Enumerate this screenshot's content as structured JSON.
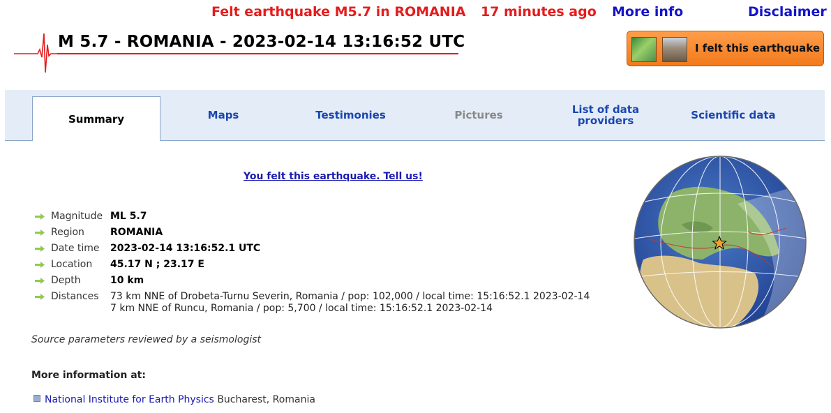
{
  "topbar": {
    "alert": "Felt earthquake M5.7 in ROMANIA",
    "time_ago": "17 minutes ago",
    "more_info": "More info",
    "disclaimer": "Disclaimer"
  },
  "header": {
    "title": "M 5.7 - ROMANIA - 2023-02-14 13:16:52 UTC",
    "felt_button": "I felt this earthquake"
  },
  "tabs": [
    {
      "label": "Summary",
      "state": "active"
    },
    {
      "label": "Maps",
      "state": "normal"
    },
    {
      "label": "Testimonies",
      "state": "normal"
    },
    {
      "label": "Pictures",
      "state": "disabled"
    },
    {
      "label": "List of data providers",
      "state": "normal"
    },
    {
      "label": "Scientific data",
      "state": "normal"
    }
  ],
  "tell_us": "You felt this earthquake. Tell us!",
  "params": {
    "magnitude_label": "Magnitude",
    "magnitude": "ML 5.7",
    "region_label": "Region",
    "region": "ROMANIA",
    "datetime_label": "Date time",
    "datetime": "2023-02-14 13:16:52.1 UTC",
    "location_label": "Location",
    "location": "45.17 N ; 23.17 E",
    "depth_label": "Depth",
    "depth": "10 km",
    "distances_label": "Distances",
    "distances": [
      "73 km NNE of Drobeta-Turnu Severin, Romania / pop: 102,000 / local time: 15:16:52.1 2023-02-14",
      "7 km NNE of Runcu, Romania / pop: 5,700 / local time: 15:16:52.1 2023-02-14"
    ]
  },
  "source_note": "Source parameters reviewed by a seismologist",
  "more_info_heading": "More information at:",
  "institution": {
    "name": "National Institute for Earth Physics",
    "location": "Bucharest, Romania"
  },
  "colors": {
    "alert_red": "#e51c1c",
    "link_blue": "#1515c8",
    "button_orange": "#f27a1c",
    "tab_bg": "#e4ecf7"
  }
}
